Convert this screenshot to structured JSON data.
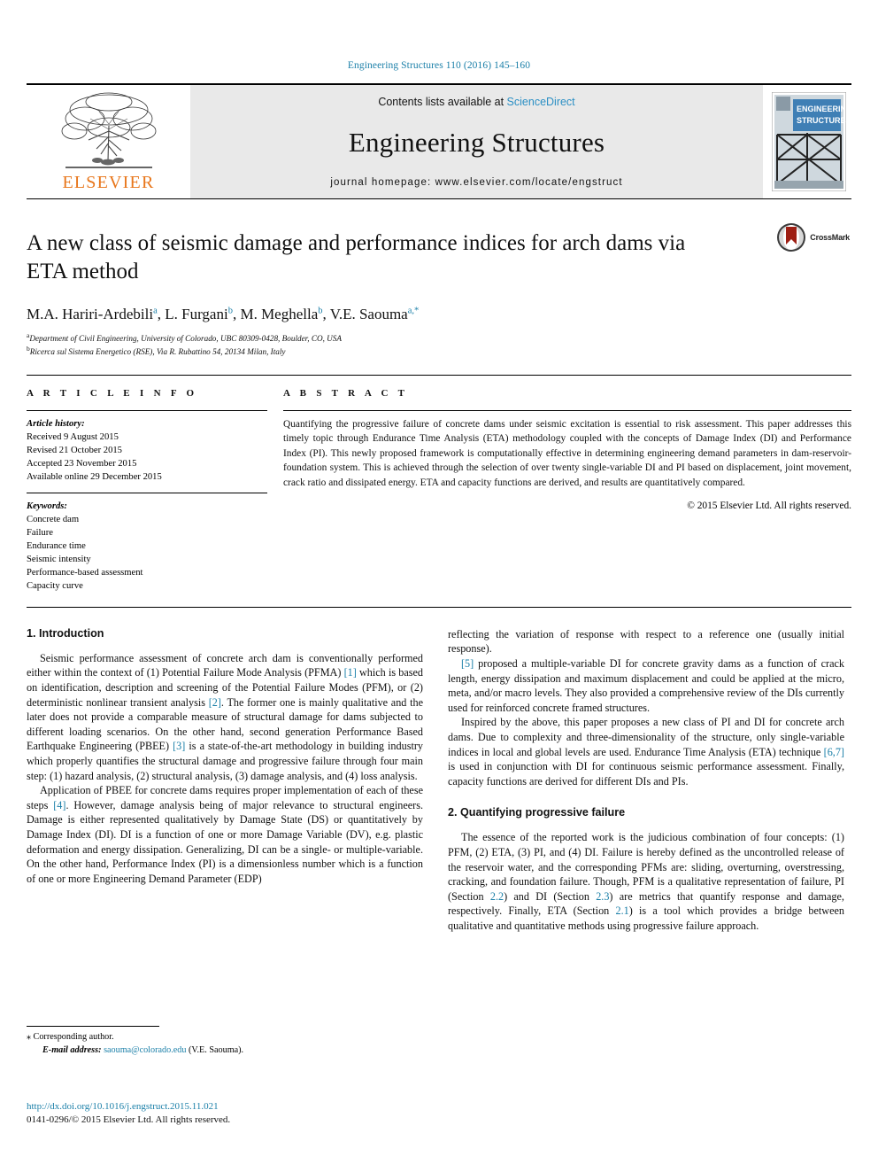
{
  "running_head": "Engineering Structures 110 (2016) 145–160",
  "masthead": {
    "publisher": "ELSEVIER",
    "contents_prefix": "Contents lists available at ",
    "contents_link": "ScienceDirect",
    "journal_name": "Engineering Structures",
    "homepage": "journal homepage: www.elsevier.com/locate/engstruct",
    "cover_line1": "ENGINEERING",
    "cover_line2": "STRUCTURES"
  },
  "title": {
    "line1": "A new class of seismic damage and performance indices for arch dams",
    "line2": "via ETA method",
    "crossmark_label": "CrossMark"
  },
  "authors": {
    "list": [
      {
        "name": "M.A. Hariri-Ardebili",
        "sup": "a"
      },
      {
        "name": "L. Furgani",
        "sup": "b"
      },
      {
        "name": "M. Meghella",
        "sup": "b"
      },
      {
        "name": "V.E. Saouma",
        "sup": "a,*"
      }
    ],
    "affiliations": [
      {
        "marker": "a",
        "text": "Department of Civil Engineering, University of Colorado, UBC 80309-0428, Boulder, CO, USA"
      },
      {
        "marker": "b",
        "text": "Ricerca sul Sistema Energetico (RSE), Via R. Rubattino 54, 20134 Milan, Italy"
      }
    ]
  },
  "article_info": {
    "heading": "A R T I C L E  I N F O",
    "history_label": "Article history:",
    "history": [
      "Received 9 August 2015",
      "Revised 21 October 2015",
      "Accepted 23 November 2015",
      "Available online 29 December 2015"
    ],
    "keywords_label": "Keywords:",
    "keywords": [
      "Concrete dam",
      "Failure",
      "Endurance time",
      "Seismic intensity",
      "Performance-based assessment",
      "Capacity curve"
    ]
  },
  "abstract": {
    "heading": "A B S T R A C T",
    "text": "Quantifying the progressive failure of concrete dams under seismic excitation is essential to risk assessment. This paper addresses this timely topic through Endurance Time Analysis (ETA) methodology coupled with the concepts of Damage Index (DI) and Performance Index (PI). This newly proposed framework is computationally effective in determining engineering demand parameters in dam-reservoir-foundation system. This is achieved through the selection of over twenty single-variable DI and PI based on displacement, joint movement, crack ratio and dissipated energy. ETA and capacity functions are derived, and results are quantitatively compared.",
    "copyright": "© 2015 Elsevier Ltd. All rights reserved."
  },
  "sections": {
    "intro_title": "1. Introduction",
    "intro_p1_a": "Seismic performance assessment of concrete arch dam is conventionally performed either within the context of (1) Potential Failure Mode Analysis (PFMA) ",
    "intro_p1_ref1": "[1]",
    "intro_p1_b": " which is based on identification, description and screening of the Potential Failure Modes (PFM), or (2) deterministic nonlinear transient analysis ",
    "intro_p1_ref2": "[2]",
    "intro_p1_c": ". The former one is mainly qualitative and the later does not provide a comparable measure of structural damage for dams subjected to different loading scenarios. On the other hand, second generation Performance Based Earthquake Engineering (PBEE) ",
    "intro_p1_ref3": "[3]",
    "intro_p1_d": " is a state-of-the-art methodology in building industry which properly quantifies the structural damage and progressive failure through four main step: (1) hazard analysis, (2) structural analysis, (3) damage analysis, and (4) loss analysis.",
    "intro_p2_a": "Application of PBEE for concrete dams requires proper implementation of each of these steps ",
    "intro_p2_ref1": "[4]",
    "intro_p2_b": ". However, damage analysis being of major relevance to structural engineers. Damage is either represented qualitatively by Damage State (DS) or quantitatively by Damage Index (DI). DI is a function of one or more Damage Variable (DV), e.g. plastic deformation and energy dissipation. Generalizing, DI can be a single- or multiple-variable. On the other hand, Performance Index (PI) is a dimensionless number which is a function of one or more Engineering Demand Parameter (EDP)",
    "right_p1": "reflecting the variation of response with respect to a reference one (usually initial response).",
    "right_p2_ref": "[5]",
    "right_p2_a": " proposed a multiple-variable DI for concrete gravity dams as a function of crack length, energy dissipation and maximum displacement and could be applied at the micro, meta, and/or macro levels. They also provided a comprehensive review of the DIs currently used for reinforced concrete framed structures.",
    "right_p3_a": "Inspired by the above, this paper proposes a new class of PI and DI for concrete arch dams. Due to complexity and three-dimensionality of the structure, only single-variable indices in local and global levels are used. Endurance Time Analysis (ETA) technique ",
    "right_p3_ref": "[6,7]",
    "right_p3_b": " is used in conjunction with DI for continuous seismic performance assessment. Finally, capacity functions are derived for different DIs and PIs.",
    "sec2_title": "2. Quantifying progressive failure",
    "sec2_p1_a": "The essence of the reported work is the judicious combination of four concepts: (1) PFM, (2) ETA, (3) PI, and (4) DI. Failure is hereby defined as the uncontrolled release of the reservoir water, and the corresponding PFMs are: sliding, overturning, overstressing, cracking, and foundation failure. Though, PFM is a qualitative representation of failure, PI (Section ",
    "sec2_ref1": "2.2",
    "sec2_p1_b": ") and DI (Section ",
    "sec2_ref2": "2.3",
    "sec2_p1_c": ") are metrics that quantify response and damage, respectively. Finally, ETA (Section ",
    "sec2_ref3": "2.1",
    "sec2_p1_d": ") is a tool which provides a bridge between qualitative and quantitative methods using progressive failure approach."
  },
  "footnote": {
    "star": "⁎",
    "corresponding": " Corresponding author.",
    "email_label": "E-mail address:",
    "email": "saouma@colorado.edu",
    "email_suffix": " (V.E. Saouma)."
  },
  "footer": {
    "doi": "http://dx.doi.org/10.1016/j.engstruct.2015.11.021",
    "issn": "0141-0296/© 2015 Elsevier Ltd. All rights reserved."
  },
  "colors": {
    "link": "#1a7fa8",
    "elsevier_orange": "#E8761B",
    "masthead_gray": "#e9e9e9",
    "cover_blue": "#3f7fb5"
  }
}
